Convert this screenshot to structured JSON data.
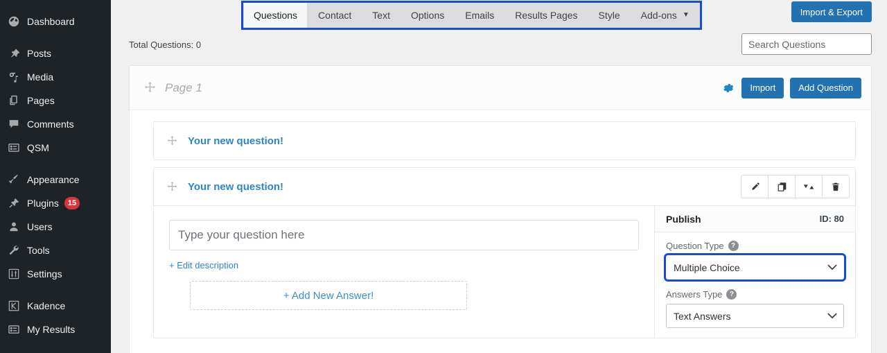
{
  "sidebar": {
    "items": [
      {
        "label": "Dashboard",
        "icon": "dashboard-icon",
        "gap_after": true
      },
      {
        "label": "Posts",
        "icon": "pin-icon",
        "gap_after": false
      },
      {
        "label": "Media",
        "icon": "media-icon",
        "gap_after": false
      },
      {
        "label": "Pages",
        "icon": "pages-icon",
        "gap_after": false
      },
      {
        "label": "Comments",
        "icon": "comments-icon",
        "gap_after": false
      },
      {
        "label": "QSM",
        "icon": "form-icon",
        "gap_after": true
      },
      {
        "label": "Appearance",
        "icon": "brush-icon",
        "gap_after": false
      },
      {
        "label": "Plugins",
        "icon": "plug-icon",
        "badge": "15",
        "gap_after": false
      },
      {
        "label": "Users",
        "icon": "user-icon",
        "gap_after": false
      },
      {
        "label": "Tools",
        "icon": "wrench-icon",
        "gap_after": false
      },
      {
        "label": "Settings",
        "icon": "sliders-icon",
        "gap_after": true
      },
      {
        "label": "Kadence",
        "icon": "kadence-icon",
        "gap_after": false
      },
      {
        "label": "My Results",
        "icon": "form-icon",
        "gap_after": false
      }
    ]
  },
  "topbar": {
    "tabs": [
      {
        "label": "Questions",
        "active": true
      },
      {
        "label": "Contact",
        "active": false
      },
      {
        "label": "Text",
        "active": false
      },
      {
        "label": "Options",
        "active": false
      },
      {
        "label": "Emails",
        "active": false
      },
      {
        "label": "Results Pages",
        "active": false
      },
      {
        "label": "Style",
        "active": false
      },
      {
        "label": "Add-ons",
        "active": false,
        "caret": "▼"
      }
    ],
    "import_export_label": "Import & Export"
  },
  "subbar": {
    "total_questions": "Total Questions: 0",
    "search_placeholder": "Search Questions",
    "search_value": ""
  },
  "page": {
    "title": "Page 1",
    "import_label": "Import",
    "add_question_label": "Add Question"
  },
  "questions": [
    {
      "title": "Your new question!",
      "expanded": false
    },
    {
      "title": "Your new question!",
      "expanded": true
    }
  ],
  "question_actions": [
    {
      "name": "edit-icon",
      "title": "Edit"
    },
    {
      "name": "duplicate-icon",
      "title": "Duplicate"
    },
    {
      "name": "sort-icon",
      "title": "Reorder"
    },
    {
      "name": "trash-icon",
      "title": "Delete"
    }
  ],
  "editor": {
    "question_placeholder": "Type your question here",
    "question_value": "",
    "edit_description_label": "+ Edit description",
    "add_answer_label": "+ Add New Answer!"
  },
  "publish_panel": {
    "title": "Publish",
    "id_label": "ID: 80",
    "question_type_label": "Question Type",
    "question_type_value": "Multiple Choice",
    "answers_type_label": "Answers Type",
    "answers_type_value": "Text Answers",
    "help_glyph": "?"
  },
  "colors": {
    "focus_blue": "#1a4ad8",
    "wp_blue": "#2271b1",
    "link_blue": "#2c87c4",
    "badge_red": "#d63638",
    "sidebar_bg": "#1d2327"
  }
}
